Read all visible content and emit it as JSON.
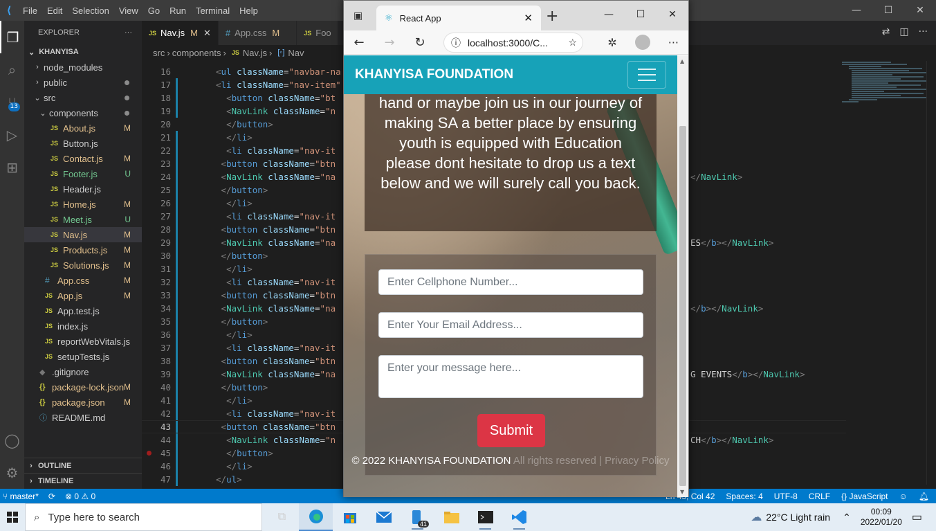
{
  "vscode": {
    "menu": [
      "File",
      "Edit",
      "Selection",
      "View",
      "Go",
      "Run",
      "Terminal",
      "Help"
    ],
    "explorer_title": "EXPLORER",
    "workspace": "KHANYISA",
    "scm_badge": "13",
    "tree": [
      {
        "label": "node_modules",
        "kind": "folder",
        "depth": 1,
        "status": ""
      },
      {
        "label": "public",
        "kind": "folder",
        "depth": 1,
        "status": "dot"
      },
      {
        "label": "src",
        "kind": "folder-open",
        "depth": 1,
        "status": "dot"
      },
      {
        "label": "components",
        "kind": "folder-open",
        "depth": 2,
        "status": "dot"
      },
      {
        "label": "About.js",
        "kind": "js",
        "depth": 3,
        "status": "M"
      },
      {
        "label": "Button.js",
        "kind": "js",
        "depth": 3,
        "status": ""
      },
      {
        "label": "Contact.js",
        "kind": "js",
        "depth": 3,
        "status": "M"
      },
      {
        "label": "Footer.js",
        "kind": "js",
        "depth": 3,
        "status": "U"
      },
      {
        "label": "Header.js",
        "kind": "js",
        "depth": 3,
        "status": ""
      },
      {
        "label": "Home.js",
        "kind": "js",
        "depth": 3,
        "status": "M"
      },
      {
        "label": "Meet.js",
        "kind": "js",
        "depth": 3,
        "status": "U"
      },
      {
        "label": "Nav.js",
        "kind": "js",
        "depth": 3,
        "status": "M",
        "selected": true
      },
      {
        "label": "Products.js",
        "kind": "js",
        "depth": 3,
        "status": "M"
      },
      {
        "label": "Solutions.js",
        "kind": "js",
        "depth": 3,
        "status": "M"
      },
      {
        "label": "App.css",
        "kind": "css",
        "depth": 2,
        "status": "M"
      },
      {
        "label": "App.js",
        "kind": "js",
        "depth": 2,
        "status": "M"
      },
      {
        "label": "App.test.js",
        "kind": "js",
        "depth": 2,
        "status": ""
      },
      {
        "label": "index.js",
        "kind": "js",
        "depth": 2,
        "status": ""
      },
      {
        "label": "reportWebVitals.js",
        "kind": "js",
        "depth": 2,
        "status": ""
      },
      {
        "label": "setupTests.js",
        "kind": "js",
        "depth": 2,
        "status": ""
      },
      {
        "label": ".gitignore",
        "kind": "git",
        "depth": 1,
        "status": ""
      },
      {
        "label": "package-lock.json",
        "kind": "json",
        "depth": 1,
        "status": "M"
      },
      {
        "label": "package.json",
        "kind": "json",
        "depth": 1,
        "status": "M"
      },
      {
        "label": "README.md",
        "kind": "info",
        "depth": 1,
        "status": ""
      }
    ],
    "outline": "OUTLINE",
    "timeline": "TIMELINE",
    "tabs": [
      {
        "label": "Nav.js",
        "icon": "JS",
        "status": "M",
        "active": true
      },
      {
        "label": "App.css",
        "icon": "#",
        "status": "M",
        "active": false
      },
      {
        "label": "Foo",
        "icon": "JS",
        "status": "",
        "active": false
      }
    ],
    "breadcrumb": [
      "src",
      "components",
      "Nav.js",
      "Nav"
    ],
    "code_lines": [
      {
        "n": "16",
        "html": "<span class='pu'>&lt;</span><span class='tg'>ul</span> <span class='at'>className</span>=<span class='st'>\"navbar-na</span>",
        "tail": "",
        "indent": 0
      },
      {
        "n": "17",
        "html": "<span class='pu'>&lt;</span><span class='tg'>li</span> <span class='at'>className</span>=<span class='st'>\"nav-item\"</span>",
        "tail": "",
        "indent": 0
      },
      {
        "n": "18",
        "html": "  <span class='pu'>&lt;</span><span class='tg'>button</span> <span class='at'>className</span>=<span class='st'>\"bt</span>",
        "tail": "",
        "indent": 1
      },
      {
        "n": "19",
        "html": "  <span class='pu'>&lt;</span><span class='cp'>NavLink</span> <span class='at'>className</span>=<span class='st'>\"n</span>",
        "tail": "<span class='pu'>&gt;</span>",
        "tailx": 695,
        "indent": 1
      },
      {
        "n": "20",
        "html": "  <span class='pu'>&lt;/</span><span class='tg'>button</span><span class='pu'>&gt;</span>",
        "tail": "",
        "indent": 1
      },
      {
        "n": "21",
        "html": "  <span class='pu'>&lt;/</span><span class='tg'>li</span><span class='pu'>&gt;</span>",
        "tail": "",
        "indent": 1
      },
      {
        "n": "22",
        "html": "  <span class='pu'>&lt;</span><span class='tg'>li</span> <span class='at'>className</span>=<span class='st'>\"nav-it</span>",
        "tail": "",
        "indent": 1
      },
      {
        "n": "23",
        "html": " <span class='pu'>&lt;</span><span class='tg'>button</span> <span class='at'>className</span>=<span class='st'>\"btn</span>",
        "tail": "",
        "indent": 0
      },
      {
        "n": "24",
        "html": " <span class='pu'>&lt;</span><span class='cp'>NavLink</span> <span class='at'>className</span>=<span class='st'>\"na</span>",
        "tail": "<span class='pu'>&lt;/</span><span class='cp'>NavLink</span><span class='pu'>&gt;</span>",
        "tailx": 793,
        "indent": 0
      },
      {
        "n": "25",
        "html": " <span class='pu'>&lt;/</span><span class='tg'>button</span><span class='pu'>&gt;</span>",
        "tail": "",
        "indent": 0
      },
      {
        "n": "26",
        "html": "  <span class='pu'>&lt;/</span><span class='tg'>li</span><span class='pu'>&gt;</span>",
        "tail": "",
        "indent": 1
      },
      {
        "n": "27",
        "html": "  <span class='pu'>&lt;</span><span class='tg'>li</span> <span class='at'>className</span>=<span class='st'>\"nav-it</span>",
        "tail": "",
        "indent": 1
      },
      {
        "n": "28",
        "html": " <span class='pu'>&lt;</span><span class='tg'>button</span> <span class='at'>className</span>=<span class='st'>\"btn</span>",
        "tail": "",
        "indent": 0
      },
      {
        "n": "29",
        "html": " <span class='pu'>&lt;</span><span class='cp'>NavLink</span> <span class='at'>className</span>=<span class='st'>\"na</span>",
        "tail": "ES<span class='pu'>&lt;/</span><span class='tg'>b</span><span class='pu'>&gt;&lt;/</span><span class='cp'>NavLink</span><span class='pu'>&gt;</span>",
        "tailx": 793,
        "indent": 0
      },
      {
        "n": "30",
        "html": " <span class='pu'>&lt;/</span><span class='tg'>button</span><span class='pu'>&gt;</span>",
        "tail": "",
        "indent": 0
      },
      {
        "n": "31",
        "html": "  <span class='pu'>&lt;/</span><span class='tg'>li</span><span class='pu'>&gt;</span>",
        "tail": "",
        "indent": 1
      },
      {
        "n": "32",
        "html": "  <span class='pu'>&lt;</span><span class='tg'>li</span> <span class='at'>className</span>=<span class='st'>\"nav-it</span>",
        "tail": "",
        "indent": 1
      },
      {
        "n": "33",
        "html": " <span class='pu'>&lt;</span><span class='tg'>button</span> <span class='at'>className</span>=<span class='st'>\"btn</span>",
        "tail": "",
        "indent": 0
      },
      {
        "n": "34",
        "html": " <span class='pu'>&lt;</span><span class='cp'>NavLink</span> <span class='at'>className</span>=<span class='st'>\"na</span>",
        "tail": "<span class='pu'>&lt;/</span><span class='tg'>b</span><span class='pu'>&gt;&lt;/</span><span class='cp'>NavLink</span><span class='pu'>&gt;</span>",
        "tailx": 793,
        "indent": 0
      },
      {
        "n": "35",
        "html": " <span class='pu'>&lt;/</span><span class='tg'>button</span><span class='pu'>&gt;</span>",
        "tail": "",
        "indent": 0
      },
      {
        "n": "36",
        "html": "  <span class='pu'>&lt;/</span><span class='tg'>li</span><span class='pu'>&gt;</span>",
        "tail": "",
        "indent": 1
      },
      {
        "n": "37",
        "html": "  <span class='pu'>&lt;</span><span class='tg'>li</span> <span class='at'>className</span>=<span class='st'>\"nav-it</span>",
        "tail": "",
        "indent": 1
      },
      {
        "n": "38",
        "html": " <span class='pu'>&lt;</span><span class='tg'>button</span> <span class='at'>className</span>=<span class='st'>\"btn</span>",
        "tail": "",
        "indent": 0
      },
      {
        "n": "39",
        "html": " <span class='pu'>&lt;</span><span class='cp'>NavLink</span> <span class='at'>className</span>=<span class='st'>\"na</span>",
        "tail": "G EVENTS<span class='pu'>&lt;/</span><span class='tg'>b</span><span class='pu'>&gt;&lt;/</span><span class='cp'>NavLink</span><span class='pu'>&gt;</span>",
        "tailx": 793,
        "indent": 0
      },
      {
        "n": "40",
        "html": " <span class='pu'>&lt;/</span><span class='tg'>button</span><span class='pu'>&gt;</span>",
        "tail": "",
        "indent": 0
      },
      {
        "n": "41",
        "html": "  <span class='pu'>&lt;/</span><span class='tg'>li</span><span class='pu'>&gt;</span>",
        "tail": "",
        "indent": 1
      },
      {
        "n": "42",
        "html": "  <span class='pu'>&lt;</span><span class='tg'>li</span> <span class='at'>className</span>=<span class='st'>\"nav-it</span>",
        "tail": "",
        "indent": 1
      },
      {
        "n": "43",
        "html": " <span class='pu'>&lt;</span><span class='tg'>button</span> <span class='at'>className</span>=<span class='st'>\"btn</span>",
        "tail": "",
        "indent": 0,
        "current": true
      },
      {
        "n": "44",
        "html": "  <span class='pu'>&lt;</span><span class='cp'>NavLink</span> <span class='at'>className</span>=<span class='st'>\"n</span>",
        "tail": "CH<span class='pu'>&lt;/</span><span class='tg'>b</span><span class='pu'>&gt;&lt;/</span><span class='cp'>NavLink</span><span class='pu'>&gt;</span>",
        "tailx": 793,
        "indent": 1
      },
      {
        "n": "45",
        "html": "  <span class='pu'>&lt;/</span><span class='tg'>button</span><span class='pu'>&gt;</span>",
        "tail": "",
        "indent": 1,
        "breakpoint": true
      },
      {
        "n": "46",
        "html": "  <span class='pu'>&lt;/</span><span class='tg'>li</span><span class='pu'>&gt;</span>",
        "tail": "",
        "indent": 1
      },
      {
        "n": "47",
        "html": "<span class='pu'>&lt;/</span><span class='tg'>ul</span><span class='pu'>&gt;</span>",
        "tail": "",
        "indent": 0
      }
    ],
    "status_left": {
      "branch": "master*",
      "errors": "0",
      "warnings": "0"
    },
    "status_right": [
      "Ln 43, Col 42",
      "Spaces: 4",
      "UTF-8",
      "CRLF",
      "{} JavaScript"
    ]
  },
  "browser": {
    "tab_title": "React App",
    "url": "localhost:3000/C...",
    "site": {
      "brand": "KHANYISA FOUNDATION",
      "intro_text": "hand or maybe join us in our journey of making SA a better place by ensuring youth is equipped with Education please dont hesitate to drop us a text below and we will surely call you back.",
      "phone_placeholder": "Enter Cellphone Number...",
      "email_placeholder": "Enter Your Email Address...",
      "message_placeholder": "Enter your message here...",
      "submit_label": "Submit",
      "footer_text": "© 2022 KHANYISA FOUNDATION",
      "footer_faint": " All rights reserved | Privacy Policy"
    }
  },
  "taskbar": {
    "search_placeholder": "Type here to search",
    "weather": "22°C  Light rain",
    "time": "00:09",
    "date": "2022/01/20",
    "badge": "41"
  }
}
